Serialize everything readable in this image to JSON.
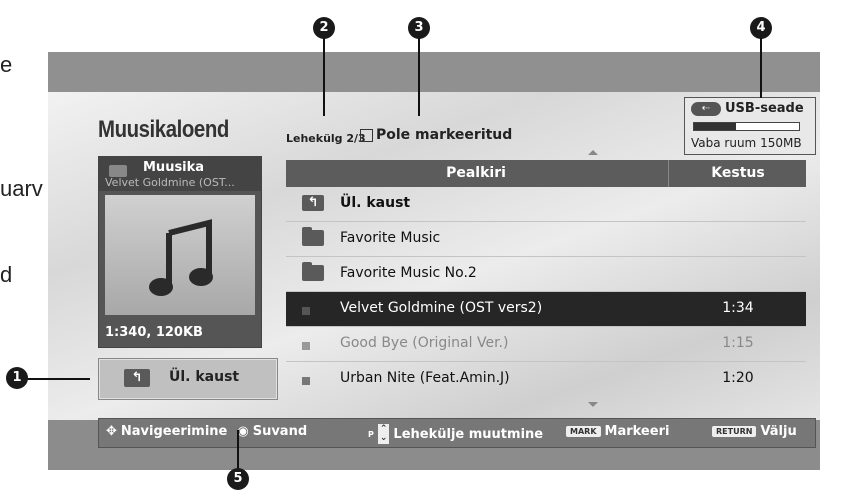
{
  "side_fragments": [
    "e",
    "uarv",
    "d"
  ],
  "window_title": "Muusikaloend",
  "page_info": "Lehekülg 2/3",
  "mark_status": "Pole markeeritud",
  "usb": {
    "label": "USB-seade",
    "free": "Vaba ruum 150MB",
    "used_fraction": 0.4
  },
  "preview": {
    "category": "Muusika",
    "file": "Velvet Goldmine (OST...",
    "info": "1:340, 120KB"
  },
  "up_button_label": "Ül. kaust",
  "list": {
    "columns": {
      "title": "Pealkiri",
      "duration": "Kestus"
    },
    "rows": [
      {
        "name": "Ül. kaust",
        "duration": "",
        "kind": "up"
      },
      {
        "name": "Favorite Music",
        "duration": "",
        "kind": "folder"
      },
      {
        "name": "Favorite Music No.2",
        "duration": "",
        "kind": "folder"
      },
      {
        "name": "Velvet Goldmine (OST vers2)",
        "duration": "1:34",
        "kind": "file-selected"
      },
      {
        "name": "Good Bye (Original Ver.)",
        "duration": "1:15",
        "kind": "file-dim"
      },
      {
        "name": "Urban Nite (Feat.Amin.J)",
        "duration": "1:20",
        "kind": "file"
      }
    ]
  },
  "hints": {
    "navigate": "Navigeerimine",
    "select": "Suvand",
    "page_key": "P",
    "page_change": "Lehekülje muutmine",
    "mark_key": "MARK",
    "mark": "Markeeri",
    "return_key": "RETURN",
    "exit": "Välju"
  },
  "callouts": [
    "1",
    "2",
    "3",
    "4",
    "5"
  ]
}
